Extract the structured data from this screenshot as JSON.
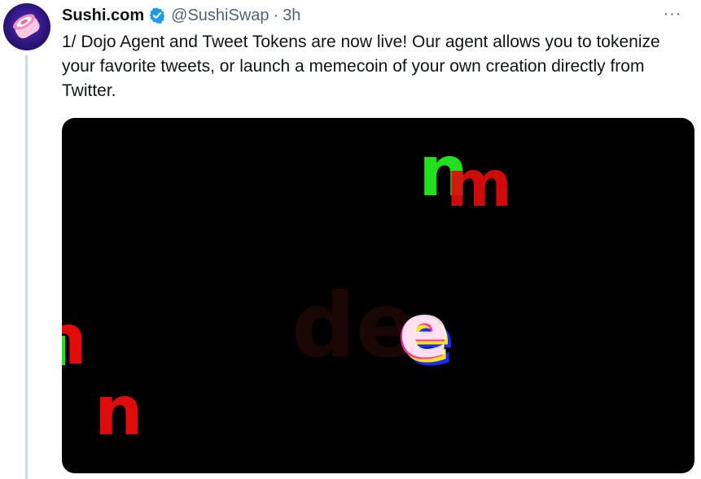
{
  "author": {
    "display_name": "Sushi.com",
    "handle": "@SushiSwap",
    "separator": "·",
    "time": "3h",
    "avatar_icon": "sushi-roll-logo-icon",
    "verified_icon": "verified-badge-icon"
  },
  "tweet": {
    "text": "1/ Dojo Agent and Tweet Tokens are now live! Our agent allows you to tokenize your favorite tweets, or launch a memecoin of your own creation directly from Twitter."
  },
  "menu": {
    "more_label": "···"
  },
  "media": {
    "type": "video",
    "background": "#000000",
    "letters": {
      "top_m_back": "n",
      "top_m_front": "m",
      "left_n": "n",
      "bottom_n": "n",
      "faded_de": "de",
      "glitch_e": "e"
    }
  },
  "colors": {
    "text_primary": "#0f1419",
    "text_secondary": "#536471",
    "verified_blue": "#1d9bf0",
    "thread_line": "#cfd9de",
    "glitch_green": "#22e01e",
    "glitch_red": "#e00b0b"
  }
}
